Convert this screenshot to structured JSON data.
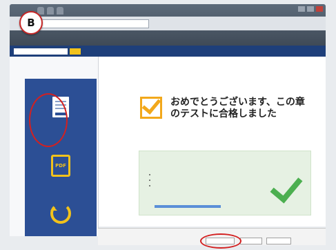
{
  "step_badge": "B",
  "browser": {
    "tabs": [
      "",
      "",
      ""
    ],
    "address": "",
    "bookmark": "",
    "right_controls": [
      "",
      "",
      ""
    ]
  },
  "site": {
    "search_placeholder": "",
    "search_button": "",
    "links": [
      "",
      ""
    ]
  },
  "sidebar": {
    "crumb1": "",
    "crumb2": "",
    "steps_title": "",
    "items": [
      {
        "label": "",
        "icon": "document-icon"
      },
      {
        "label": "",
        "icon": "pdf-icon"
      },
      {
        "label": "",
        "icon": "redo-icon"
      }
    ],
    "footer_text": "",
    "footer_link": ""
  },
  "main": {
    "topline": "",
    "desc": "",
    "congrats": "おめでとうございます、この章のテストに合格しました",
    "result_title": "",
    "result_items": [
      "",
      "",
      ""
    ]
  },
  "notification": {
    "text": "",
    "open": "",
    "save": "",
    "cancel": ""
  },
  "colors": {
    "nav": "#1e3f7a",
    "rail": "#2c4f95",
    "accent": "#f2c21b",
    "success": "#4caf50",
    "highlight_ring": "#d32020"
  }
}
